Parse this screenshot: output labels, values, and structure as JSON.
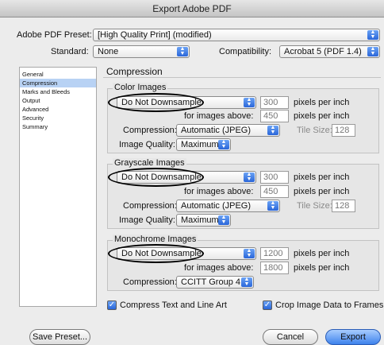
{
  "window": {
    "title": "Export Adobe PDF"
  },
  "preset": {
    "label": "Adobe PDF Preset:",
    "value": "[High Quality Print] (modified)"
  },
  "standard": {
    "label": "Standard:",
    "value": "None"
  },
  "compatibility": {
    "label": "Compatibility:",
    "value": "Acrobat 5 (PDF 1.4)"
  },
  "sidebar": {
    "items": [
      {
        "label": "General"
      },
      {
        "label": "Compression"
      },
      {
        "label": "Marks and Bleeds"
      },
      {
        "label": "Output"
      },
      {
        "label": "Advanced"
      },
      {
        "label": "Security"
      },
      {
        "label": "Summary"
      }
    ],
    "selected": "Compression"
  },
  "panel": {
    "title": "Compression"
  },
  "common": {
    "ppi": "pixels per inch",
    "above_label": "for images above:",
    "compression_label": "Compression:",
    "quality_label": "Image Quality:",
    "tile_label": "Tile Size:"
  },
  "color": {
    "title": "Color Images",
    "downsample": "Do Not Downsample",
    "ppi_value": "300",
    "above_value": "450",
    "compression": "Automatic (JPEG)",
    "tile_value": "128",
    "quality": "Maximum"
  },
  "grayscale": {
    "title": "Grayscale Images",
    "downsample": "Do Not Downsample",
    "ppi_value": "300",
    "above_value": "450",
    "compression": "Automatic (JPEG)",
    "tile_value": "128",
    "quality": "Maximum"
  },
  "monochrome": {
    "title": "Monochrome Images",
    "downsample": "Do Not Downsample",
    "ppi_value": "1200",
    "above_value": "1800",
    "compression": "CCITT Group 4"
  },
  "options": {
    "compress_text": "Compress Text and Line Art",
    "crop_image": "Crop Image Data to Frames"
  },
  "buttons": {
    "save_preset": "Save Preset...",
    "cancel": "Cancel",
    "export": "Export"
  }
}
